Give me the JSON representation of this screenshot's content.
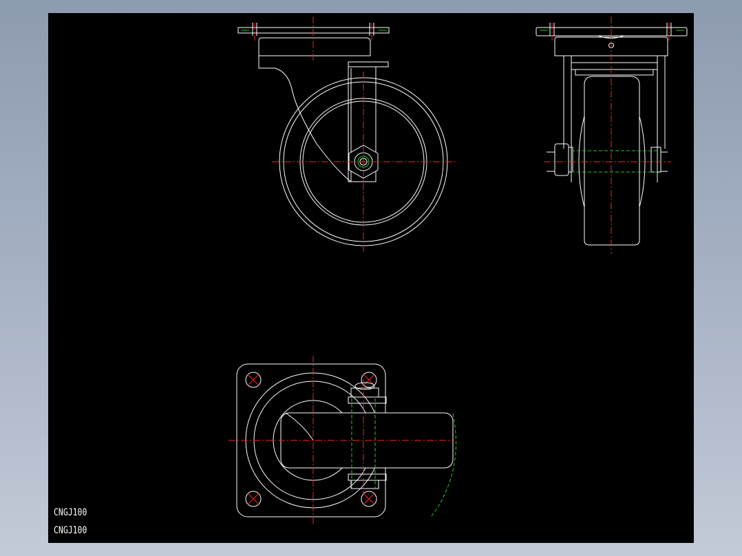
{
  "labels": [
    "CNGJ100",
    "CNGJ100"
  ],
  "colors": {
    "background": "#000000",
    "outline": "#ffffff",
    "center_line": "#ff2020",
    "hidden_line": "#20d020",
    "frame_gradient_top": "#8d9bb0",
    "frame_gradient_bottom": "#c3cad7"
  }
}
